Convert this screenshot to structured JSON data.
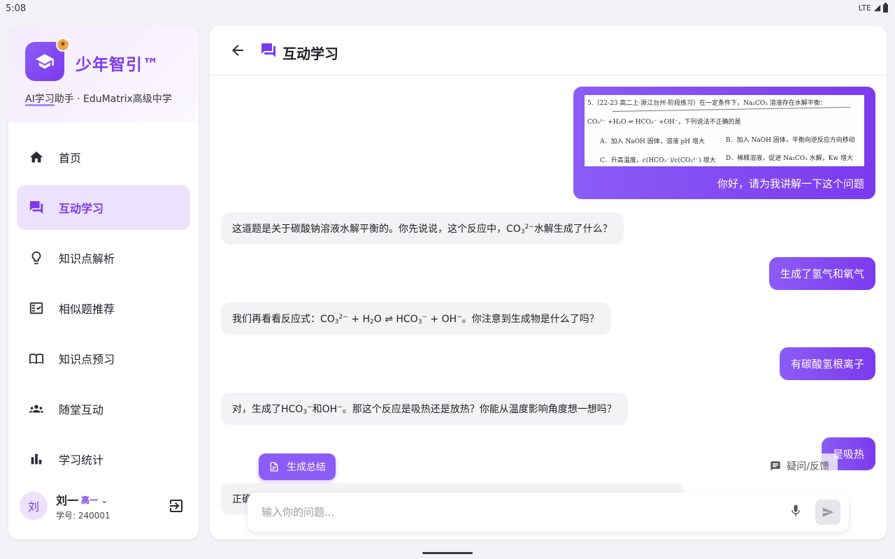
{
  "status": {
    "time": "5:08",
    "network": "LTE"
  },
  "brand": {
    "name": "少年智引™",
    "subtitle": "AI学习助手 · EduMatrix高级中学",
    "badge_icon": "star-icon",
    "logo_icon": "graduation-cap-icon"
  },
  "nav": {
    "items": [
      {
        "label": "首页",
        "icon": "home-icon",
        "active": false
      },
      {
        "label": "互动学习",
        "icon": "chat-icon",
        "active": true
      },
      {
        "label": "知识点解析",
        "icon": "lightbulb-icon",
        "active": false
      },
      {
        "label": "相似题推荐",
        "icon": "checklist-icon",
        "active": false
      },
      {
        "label": "知识点预习",
        "icon": "book-icon",
        "active": false
      },
      {
        "label": "随堂互动",
        "icon": "people-icon",
        "active": false
      },
      {
        "label": "学习统计",
        "icon": "bar-chart-icon",
        "active": false
      }
    ]
  },
  "user": {
    "avatar": "刘",
    "name": "刘一",
    "grade": "高一",
    "student_id": "学号: 240001"
  },
  "header": {
    "title": "互动学习"
  },
  "question_image": {
    "line1": "5.（22-23 高二上·浙江台州·阶段练习）在一定条件下，Na₂CO₃ 溶液存在水解平衡：",
    "line2": "CO₃²⁻ +H₂O ⇌ HCO₃⁻ +OH⁻，下列说法不正确的是",
    "optA": "A．加入 NaOH 固体，溶液 pH 增大",
    "optB": "B．加入 NaOH 固体，平衡向逆反应方向移动",
    "optC": "C．升高温度，c(HCO₃⁻)/c(CO₃²⁻) 增大",
    "optD": "D．稀释溶液，促进 Na₂CO₃ 水解，Kw 增大"
  },
  "messages": {
    "m1": "你好，请为我讲解一下这个问题",
    "m2a": "这道题是关于碳酸钠溶液水解平衡的。你先说说，这个反应中，CO",
    "m2b": "水解生成了什么？",
    "m3": "生成了氢气和氧气",
    "m4a": "我们再看看反应式：CO",
    "m4b": " + H",
    "m4c": "O ⇌ HCO",
    "m4d": " + OH",
    "m4e": "。你注意到生成物是什么了吗？",
    "m5": "有碳酸氢根离子",
    "m6a": "对，生成了HCO",
    "m6b": "和OH",
    "m6c": "。那这个反应是吸热还是放热？你能从温度影响角度想一想吗？",
    "m7": "是吸热",
    "m8": "正确"
  },
  "chem": {
    "sub3": "3",
    "sub2": "2",
    "charge2": "2−",
    "charge1": "−"
  },
  "actions": {
    "summary": "生成总结",
    "feedback": "疑问/反馈"
  },
  "input": {
    "placeholder": "输入你的问题..."
  },
  "colors": {
    "accent": "#7c3aed",
    "accent_light": "#ece2fd",
    "bot_bubble": "#f3f3f5"
  }
}
